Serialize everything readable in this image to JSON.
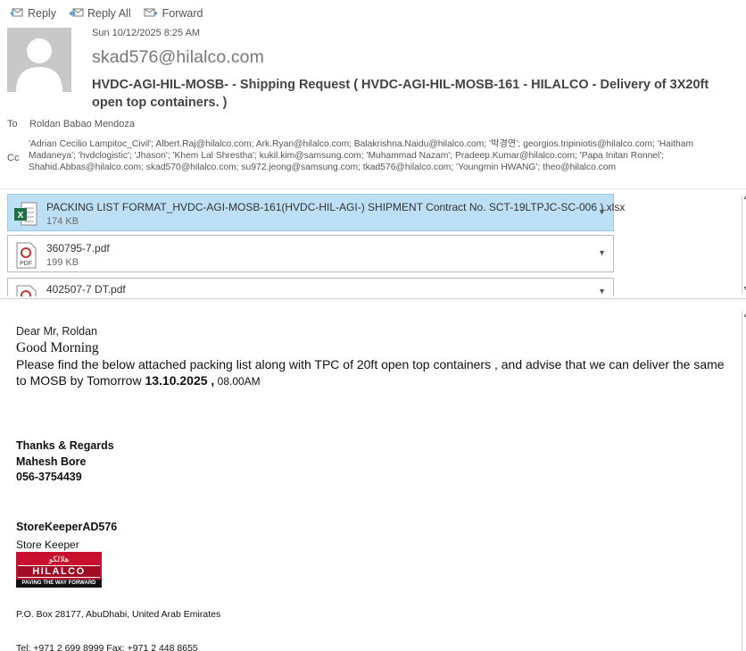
{
  "toolbar": {
    "reply": "Reply",
    "reply_all": "Reply All",
    "forward": "Forward"
  },
  "header": {
    "date": "Sun 10/12/2025 8:25 AM",
    "sender": "skad576@hilalco.com",
    "subject": "HVDC-AGI-HIL-MOSB- - Shipping Request ( HVDC-AGI-HIL-MOSB-161 - HILALCO - Delivery of   3X20ft open top containers.   )",
    "to_label": "To",
    "to": "Roldan Babao Mendoza",
    "cc_label": "Cc",
    "cc": "'Adrian Cecilio Lampitoc_Civil'; Albert.Raj@hilalco.com; Ark.Ryan@hilalco.com; Balakrishna.Naidu@hilalco.com; '박경연'; georgios.tripiniotis@hilalco.com; 'Haitham Madaneya'; 'hvdclogistic'; 'Jhason'; 'Khem Lal Shrestha'; kukil.kim@samsung.com; 'Muhammad Nazam'; Pradeep.Kumar@hilalco.com; 'Papa Initan Ronnel'; Shahid.Abbas@hilalco.com; skad570@hilalco.com; su972.jeong@samsung.com; tkad576@hilalco.com; 'Youngmin HWANG'; theo@hilalco.com"
  },
  "attachments": [
    {
      "name": "PACKING LIST FORMAT_HVDC-AGI-MOSB-161(HVDC-HIL-AGI-)  SHIPMENT Contract No. SCT-19LTPJC-SC-006 ).xlsx",
      "size": "174 KB",
      "icon": "excel-icon",
      "selected": true
    },
    {
      "name": "360795-7.pdf",
      "size": "199 KB",
      "icon": "pdf-icon",
      "selected": false
    },
    {
      "name": "402507-7 DT.pdf",
      "size": "",
      "icon": "pdf-icon",
      "selected": false
    }
  ],
  "body": {
    "greeting": "Dear Mr, Roldan",
    "good_morning": "Good Morning",
    "para_1": " Please find the below attached packing list  along with TPC of   20ft open top containers   ,  and advise that we can deliver the same to  MOSB  by Tomorrow ",
    "para_date": " 13.10.2025  ,",
    "para_time": " 08.00AM",
    "thanks": "Thanks & Regards",
    "name": "Mahesh Bore",
    "phone": "056-3754439",
    "role_name": "StoreKeeperAD576",
    "role": "Store Keeper",
    "logo_brand": "HILALCO",
    "logo_arabic": "هلالكو",
    "logo_tagline": "PAVING THE WAY FORWARD",
    "address": "P.O. Box 28177, AbuDhabi, United Arab Emirates",
    "tel": "Tel:  +971 2 699 8999  Fax: +971 2 448 8655"
  },
  "colors": {
    "selected_attachment": "#bde0f7",
    "logo_red": "#c8102e"
  }
}
